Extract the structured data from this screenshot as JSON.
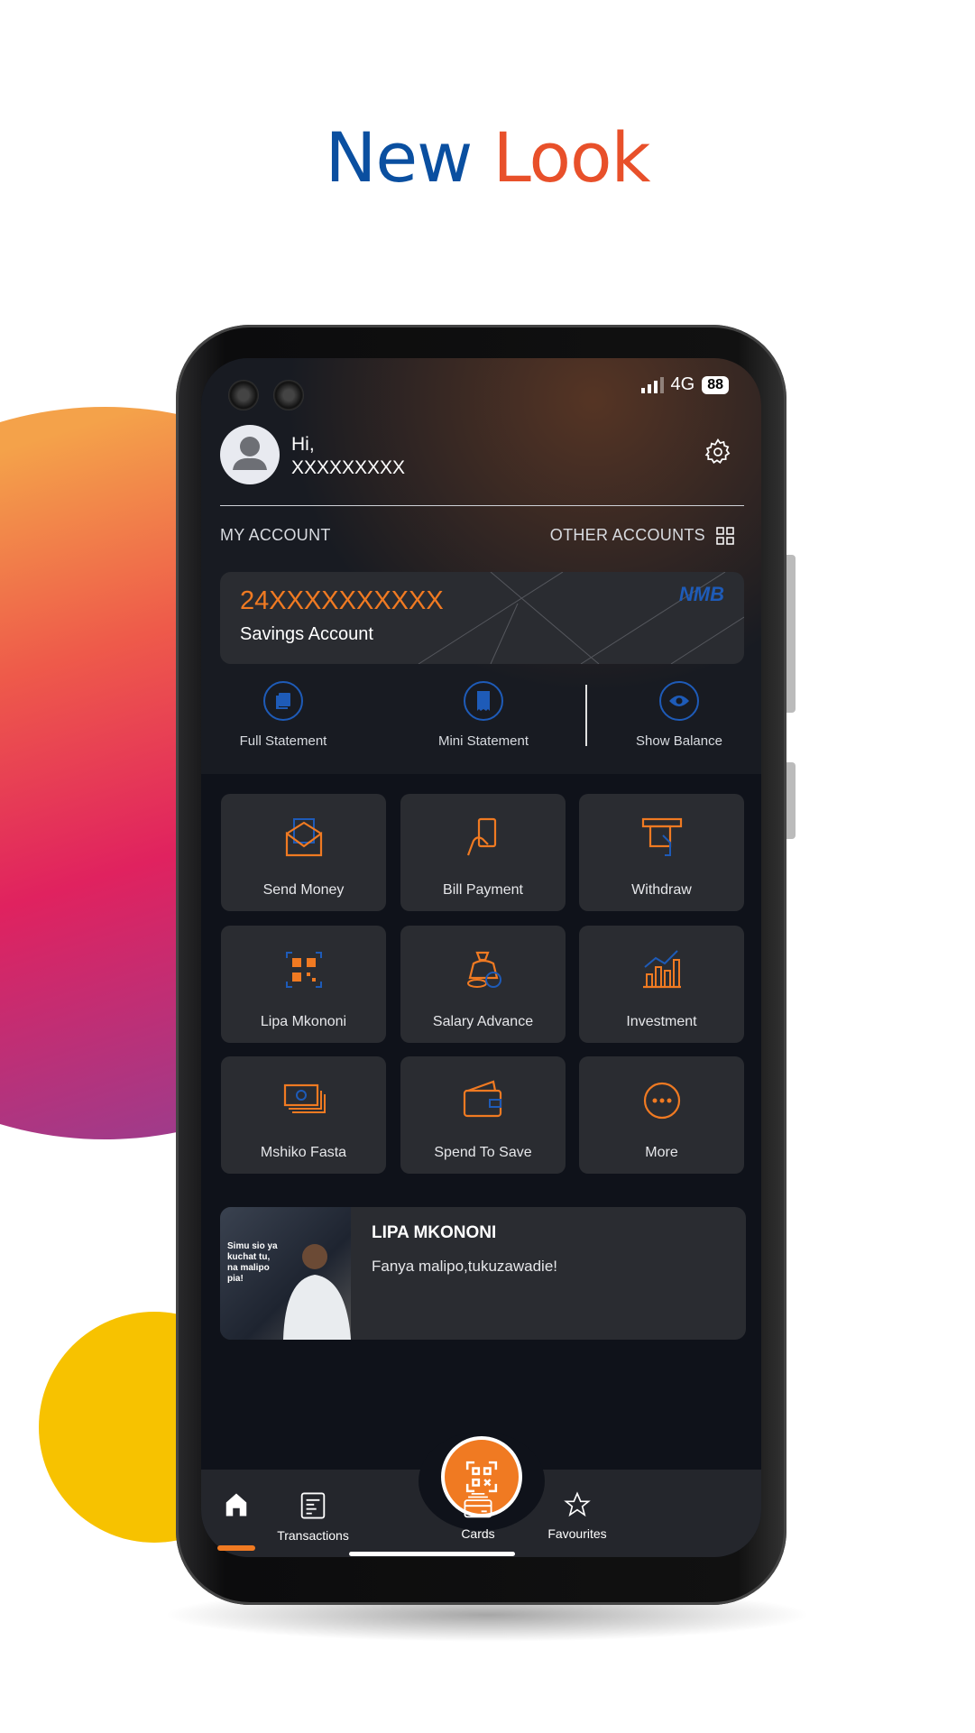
{
  "headline": {
    "part1": "New",
    "part2": "Look"
  },
  "colors": {
    "accent": "#f07a22",
    "blue": "#1e5bb8",
    "headline_blue": "#0a4fa0",
    "headline_orange": "#e8502a"
  },
  "status": {
    "network": "4G",
    "battery": "88"
  },
  "user": {
    "greeting": "Hi,",
    "name": "XXXXXXXXX"
  },
  "account": {
    "section_label": "MY ACCOUNT",
    "other_label": "OTHER ACCOUNTS",
    "number": "24XXXXXXXXXX",
    "type": "Savings Account",
    "bank_logo": "NMB"
  },
  "quick_actions": [
    {
      "label": "Full Statement",
      "icon": "document-stack-icon"
    },
    {
      "label": "Mini Statement",
      "icon": "receipt-icon"
    },
    {
      "label": "Show Balance",
      "icon": "eye-icon"
    }
  ],
  "services": [
    {
      "label": "Send Money",
      "icon": "envelope-money-icon"
    },
    {
      "label": "Bill Payment",
      "icon": "hand-bill-icon"
    },
    {
      "label": "Withdraw",
      "icon": "atm-icon"
    },
    {
      "label": "Lipa Mkononi",
      "icon": "qr-code-icon"
    },
    {
      "label": "Salary Advance",
      "icon": "money-bag-icon"
    },
    {
      "label": "Investment",
      "icon": "chart-icon"
    },
    {
      "label": "Mshiko Fasta",
      "icon": "banknotes-icon"
    },
    {
      "label": "Spend To Save",
      "icon": "wallet-icon"
    },
    {
      "label": "More",
      "icon": "more-icon"
    }
  ],
  "banner": {
    "title": "LIPA MKONONI",
    "subtitle": "Fanya malipo,tukuzawadie!",
    "image_text": "Simu sio ya kuchat tu, na malipo pia!"
  },
  "nav": [
    {
      "label": "",
      "icon": "home-icon",
      "active": true
    },
    {
      "label": "Transactions",
      "icon": "transactions-icon"
    },
    {
      "label": "Cards",
      "icon": "card-icon"
    },
    {
      "label": "Favourites",
      "icon": "star-icon"
    }
  ]
}
